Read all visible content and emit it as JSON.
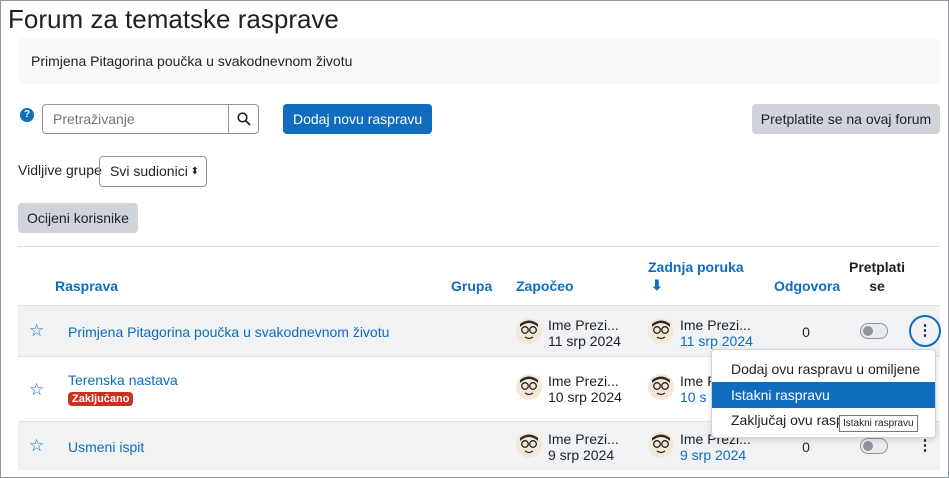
{
  "page": {
    "title": "Forum za tematske rasprave",
    "intro": "Primjena Pitagorina poučka u svakodnevnom životu"
  },
  "toolbar": {
    "help_label": "?",
    "search_placeholder": "Pretraživanje",
    "add_discussion": "Dodaj novu raspravu",
    "subscribe_forum": "Pretplatite se na ovaj forum"
  },
  "groups": {
    "label": "Vidljive grupe",
    "selected": "Svi sudionici"
  },
  "grade_button": "Ocijeni korisnike",
  "table": {
    "headers": {
      "discussion": "Rasprava",
      "group": "Grupa",
      "started": "Započeo",
      "last_post_line1": "Zadnja poruka",
      "last_post_arrow": "⬇",
      "replies": "Odgovora",
      "subscribe_line1": "Pretplati",
      "subscribe_line2": "se"
    },
    "rows": [
      {
        "title": "Primjena Pitagorina poučka u svakodnevnom životu",
        "badge": "",
        "starter_name": "Ime Prezi...",
        "starter_date": "11 srp 2024",
        "last_name": "Ime Prezi...",
        "last_date": "11 srp 2024",
        "replies": "0"
      },
      {
        "title": "Terenska nastava",
        "badge": "Zaključano",
        "starter_name": "Ime Prezi...",
        "starter_date": "10 srp 2024",
        "last_name": "Ime Prezi",
        "last_date": "10 s",
        "replies": ""
      },
      {
        "title": "Usmeni ispit",
        "badge": "",
        "starter_name": "Ime Prezi...",
        "starter_date": "9 srp 2024",
        "last_name": "Ime Prezi...",
        "last_date": "9 srp 2024",
        "replies": "0"
      }
    ]
  },
  "menu": {
    "items": [
      "Dodaj ovu raspravu u omiljene",
      "Istakni raspravu",
      "Zaključaj ovu rasp"
    ],
    "active_index": 1,
    "tooltip": "Istakni raspravu"
  },
  "icons": {
    "star": "☆",
    "kebab": "⋮"
  },
  "colors": {
    "accent": "#0f6cbf",
    "badge": "#ca3120",
    "button_secondary": "#ced4da"
  }
}
